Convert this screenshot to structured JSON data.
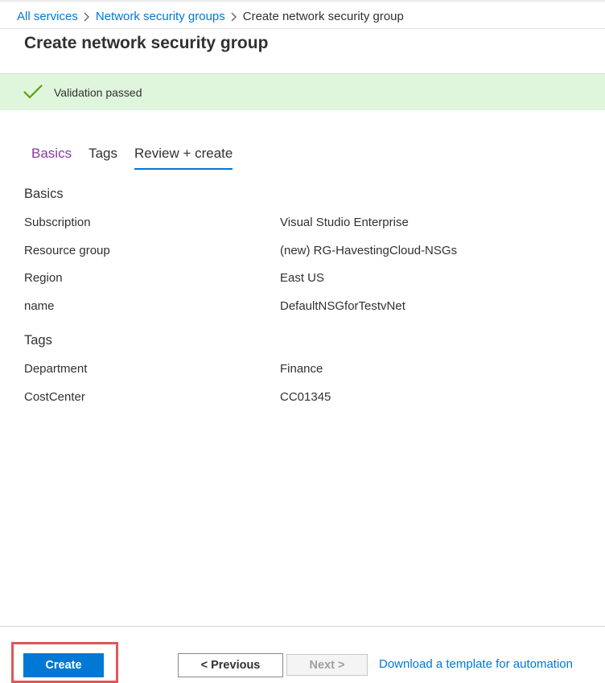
{
  "breadcrumb": {
    "items": [
      "All services",
      "Network security groups"
    ],
    "current": "Create network security group"
  },
  "page": {
    "title": "Create network security group"
  },
  "validation": {
    "text": "Validation passed",
    "color": "#dff6dd"
  },
  "tabs": [
    {
      "label": "Basics"
    },
    {
      "label": "Tags"
    },
    {
      "label": "Review + create"
    }
  ],
  "review": {
    "basics": {
      "heading": "Basics",
      "rows": [
        {
          "label": "Subscription",
          "value": "Visual Studio Enterprise"
        },
        {
          "label": "Resource group",
          "value": "(new) RG-HavestingCloud-NSGs"
        },
        {
          "label": "Region",
          "value": "East US"
        },
        {
          "label": "name",
          "value": "DefaultNSGforTestvNet"
        }
      ]
    },
    "tags": {
      "heading": "Tags",
      "rows": [
        {
          "label": "Department",
          "value": "Finance"
        },
        {
          "label": "CostCenter",
          "value": "CC01345"
        }
      ]
    }
  },
  "footer": {
    "create_label": "Create",
    "previous_label": "< Previous",
    "next_label": "Next >",
    "download_label": "Download a template for automation"
  },
  "colors": {
    "accent": "#0078d4",
    "highlight": "#e0555a",
    "visited_tab": "#8a3aa0"
  }
}
